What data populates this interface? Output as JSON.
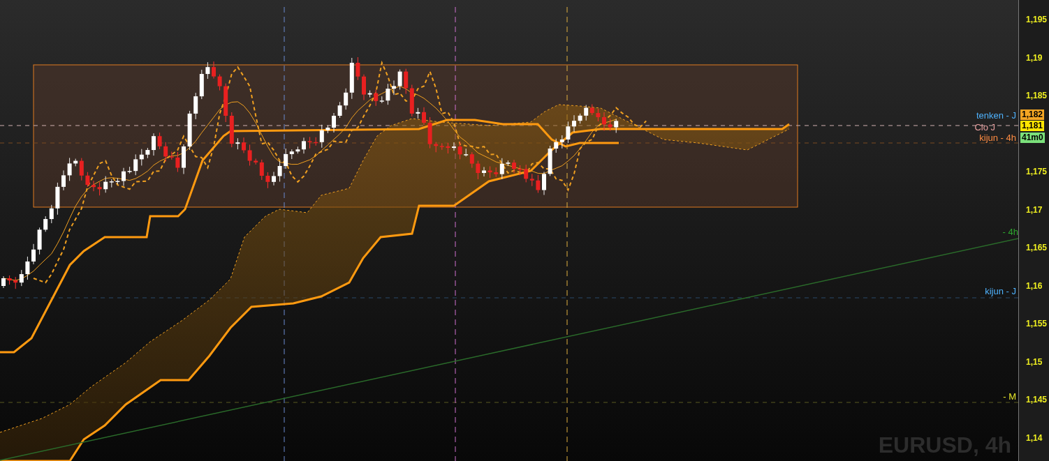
{
  "chart": {
    "symbol": "EURUSD, 4h",
    "axis_ticks": [
      "1,195",
      "1,19",
      "1,185",
      "1,175",
      "1,17",
      "1,165",
      "1,16",
      "1,155",
      "1,15",
      "1,145",
      "1,14"
    ],
    "line_labels": [
      {
        "text": "tenken - J",
        "color": "#4fb3ff"
      },
      {
        "text": "Clo J",
        "color": "#e8a0a0"
      },
      {
        "text": "kijun - 4h",
        "color": "#ff8c42"
      },
      {
        "text": "- 4h",
        "color": "#2ea82e"
      },
      {
        "text": "kijun - J",
        "color": "#4fb3ff"
      },
      {
        "text": "- M",
        "color": "#e8e82a"
      }
    ],
    "price_tags": [
      {
        "text": "1,182",
        "color": "#f5a623"
      },
      {
        "text": "1,181",
        "color": "#ffe600"
      },
      {
        "text": "41m0",
        "color": "#7be07b"
      }
    ]
  }
}
